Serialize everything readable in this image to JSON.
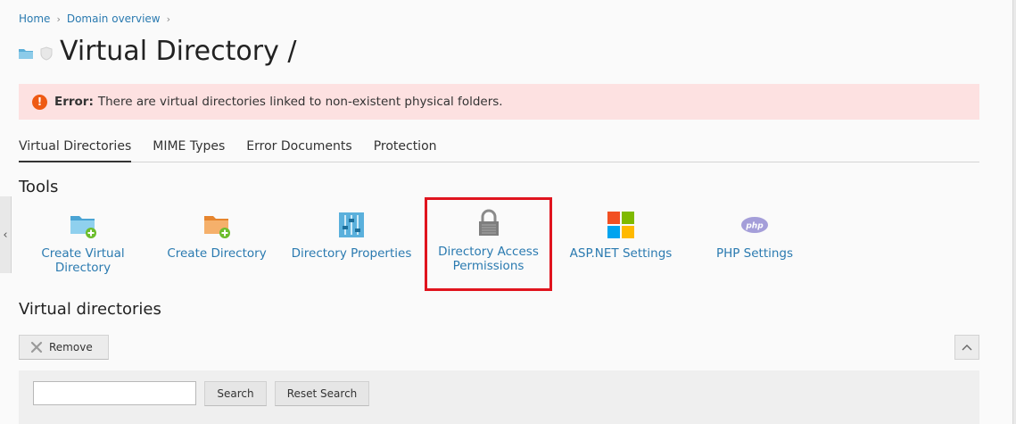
{
  "breadcrumb": {
    "home": "Home",
    "domain_overview": "Domain overview"
  },
  "page": {
    "title": "Virtual Directory /"
  },
  "alert": {
    "label": "Error:",
    "message": "There are virtual directories linked to non-existent physical folders."
  },
  "tabs": [
    {
      "label": "Virtual Directories"
    },
    {
      "label": "MIME Types"
    },
    {
      "label": "Error Documents"
    },
    {
      "label": "Protection"
    }
  ],
  "tools": {
    "title": "Tools",
    "items": [
      {
        "line1": "Create Virtual",
        "line2": "Directory",
        "icon": "folder-add-icon"
      },
      {
        "line1": "Create Directory",
        "line2": "",
        "icon": "folder-add-orange-icon"
      },
      {
        "line1": "Directory Properties",
        "line2": "",
        "icon": "properties-sliders-icon"
      },
      {
        "line1": "Directory Access",
        "line2": "Permissions",
        "icon": "lock-icon"
      },
      {
        "line1": "ASP.NET Settings",
        "line2": "",
        "icon": "windows-logo-icon"
      },
      {
        "line1": "PHP Settings",
        "line2": "",
        "icon": "php-icon"
      }
    ]
  },
  "virtual_directories": {
    "title": "Virtual directories",
    "remove_label": "Remove",
    "search_value": "",
    "search_label": "Search",
    "reset_label": "Reset Search"
  },
  "colors": {
    "link": "#2a7ab0",
    "error_bg": "#fde1e1",
    "error_icon": "#ee5a14",
    "highlight": "#e0141e"
  }
}
